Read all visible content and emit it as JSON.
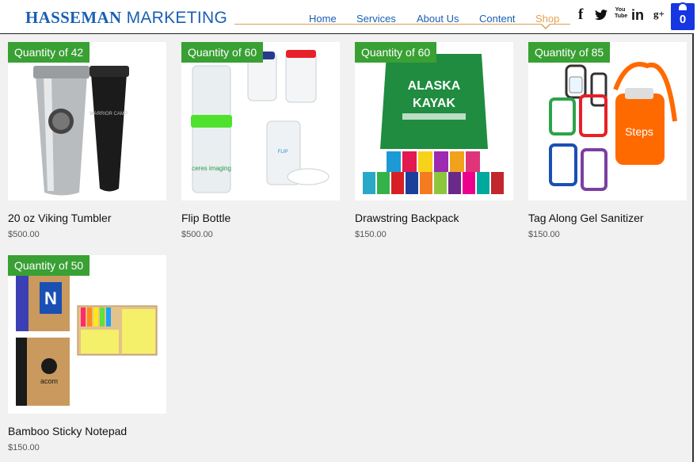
{
  "brand": {
    "name_bold": "HASSEMAN",
    "name_light": "MARKETING",
    "color": "#1a5fb4"
  },
  "nav": {
    "items": [
      {
        "label": "Home"
      },
      {
        "label": "Services"
      },
      {
        "label": "About Us"
      },
      {
        "label": "Content"
      },
      {
        "label": "Shop",
        "active": true
      }
    ],
    "accent": "#e8a050"
  },
  "social": [
    {
      "icon": "facebook-icon",
      "glyph": "f"
    },
    {
      "icon": "twitter-icon",
      "glyph": "🐦"
    },
    {
      "icon": "youtube-icon",
      "glyph": "You Tube"
    },
    {
      "icon": "linkedin-icon",
      "glyph": "in"
    },
    {
      "icon": "google-plus-icon",
      "glyph": "g+"
    }
  ],
  "cart": {
    "count": "0",
    "icon": "shopping-bag-icon",
    "color": "#1536e0"
  },
  "products": [
    {
      "ribbon": "Quantity of 42",
      "name": "20 oz Viking Tumbler",
      "price": "$500.00"
    },
    {
      "ribbon": "Quantity of 60",
      "name": "Flip Bottle",
      "price": "$500.00"
    },
    {
      "ribbon": "Quantity of 60",
      "name": "Drawstring Backpack",
      "price": "$150.00"
    },
    {
      "ribbon": "Quantity of 85",
      "name": "Tag Along Gel Sanitizer",
      "price": "$150.00"
    },
    {
      "ribbon": "Quantity of 50",
      "name": "Bamboo Sticky Notepad",
      "price": "$150.00"
    }
  ],
  "product_images": [
    {
      "icon": "tumbler-image",
      "text": [
        "WARRIOR CAMP"
      ]
    },
    {
      "icon": "flip-bottle-image",
      "text": [
        "ceres imaging",
        "FLIP"
      ]
    },
    {
      "icon": "backpack-image",
      "text": [
        "ALASKA",
        "KAYAK"
      ]
    },
    {
      "icon": "sanitizer-image",
      "text": [
        "Steps"
      ]
    },
    {
      "icon": "notepad-image",
      "text": [
        "N",
        "acom"
      ]
    }
  ],
  "ribbon_color": "#39a034"
}
